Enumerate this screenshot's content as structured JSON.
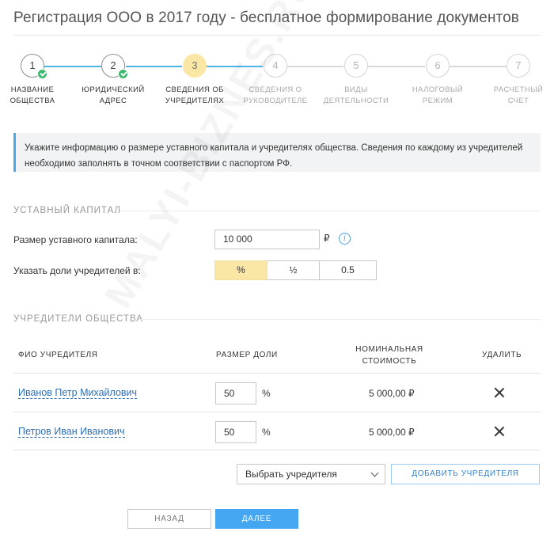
{
  "page": {
    "title": "Регистрация ООО в 2017 году - бесплатное формирование документов"
  },
  "steps": [
    {
      "number": "1",
      "label": "НАЗВАНИЕ\nОБЩЕСТВА",
      "state": "done"
    },
    {
      "number": "2",
      "label": "ЮРИДИЧЕСКИЙ\nАДРЕС",
      "state": "done"
    },
    {
      "number": "3",
      "label": "СВЕДЕНИЯ ОБ\nУЧРЕДИТЕЛЯХ",
      "state": "current"
    },
    {
      "number": "4",
      "label": "СВЕДЕНИЯ О\nРУКОВОДИТЕЛЕ",
      "state": "future"
    },
    {
      "number": "5",
      "label": "ВИДЫ\nДЕЯТЕЛЬНОСТИ",
      "state": "future"
    },
    {
      "number": "6",
      "label": "НАЛОГОВЫЙ\nРЕЖИМ",
      "state": "future"
    },
    {
      "number": "7",
      "label": "РАСЧЕТНЫЙ\nСЧЕТ",
      "state": "future"
    }
  ],
  "notice": {
    "text": "Укажите информацию о размере уставного капитала и учредителях общества. Сведения по каждому из учредителей необходимо заполнять в точном соответствии с паспортом РФ."
  },
  "capital": {
    "heading": "УСТАВНЫЙ КАПИТАЛ",
    "size_label": "Размер уставного капитала:",
    "size_value": "10 000",
    "currency": "₽",
    "info_icon": "i",
    "share_label": "Указать доли учредителей в:",
    "share_options": [
      "%",
      "½",
      "0.5"
    ],
    "share_selected": "%"
  },
  "founders": {
    "heading": "УЧРЕДИТЕЛИ ОБЩЕСТВА",
    "columns": {
      "name": "ФИО УЧРЕДИТЕЛЯ",
      "share": "РАЗМЕР ДОЛИ",
      "nominal": "НОМИНАЛЬНАЯ\nСТОИМОСТЬ",
      "delete": "УДАЛИТЬ"
    },
    "rows": [
      {
        "name": "Иванов Петр Михайлович",
        "share": "50",
        "unit": "%",
        "nominal": "5 000,00 ₽"
      },
      {
        "name": "Петров Иван Иванович",
        "share": "50",
        "unit": "%",
        "nominal": "5 000,00 ₽"
      }
    ],
    "select_placeholder": "Выбрать учредителя",
    "add_label": "ДОБАВИТЬ УЧРЕДИТЕЛЯ"
  },
  "nav": {
    "back_label": "НАЗАД",
    "next_label": "ДАЛЕЕ"
  },
  "watermark": "MALYI-BIZNES.RU",
  "colors": {
    "accent_blue": "#45a7f2",
    "progress_line": "#4cb4e4",
    "current_step": "#fbe7a5",
    "done_check": "#3db96e",
    "link": "#2c6fb4"
  }
}
